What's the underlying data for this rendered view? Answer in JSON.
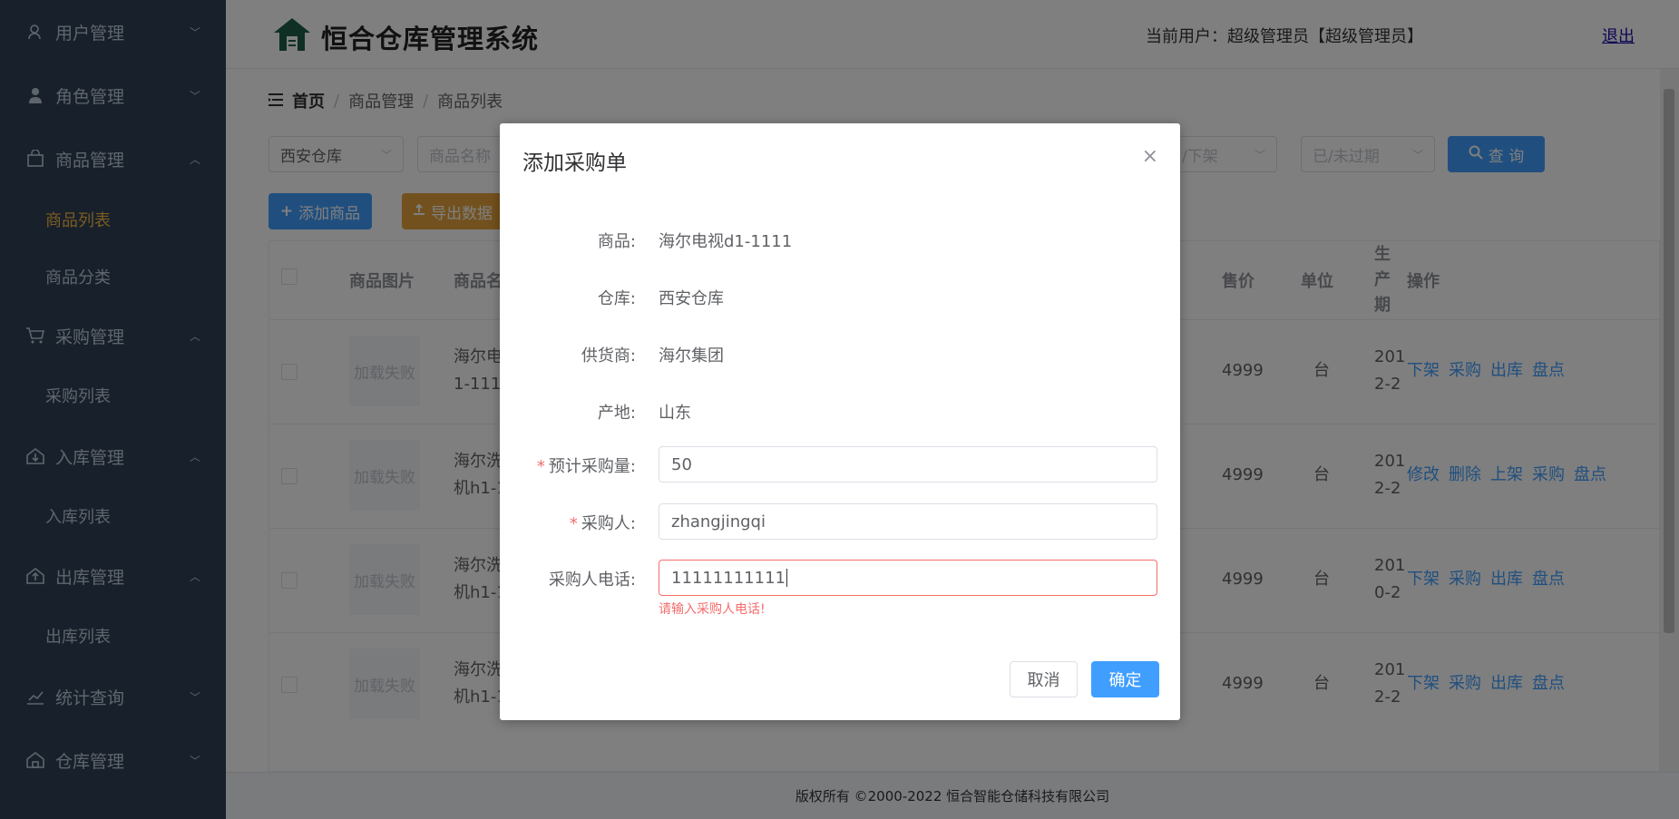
{
  "app": {
    "title": "恒合仓库管理系统",
    "user_label": "当前用户：超级管理员【超级管理员】",
    "logout": "退出"
  },
  "sidebar": {
    "menus": [
      {
        "label": "用户管理",
        "icon": "user-icon",
        "arrow": "﹀"
      },
      {
        "label": "角色管理",
        "icon": "person-icon",
        "arrow": "﹀"
      },
      {
        "label": "商品管理",
        "icon": "bag-icon",
        "arrow": "︿"
      },
      {
        "label": "采购管理",
        "icon": "cart-icon",
        "arrow": "︿"
      },
      {
        "label": "入库管理",
        "icon": "inbound-icon",
        "arrow": "︿"
      },
      {
        "label": "出库管理",
        "icon": "outbound-icon",
        "arrow": "︿"
      },
      {
        "label": "统计查询",
        "icon": "stats-icon",
        "arrow": "﹀"
      },
      {
        "label": "仓库管理",
        "icon": "warehouse-icon",
        "arrow": "﹀"
      }
    ],
    "subs": {
      "goods_list": "商品列表",
      "goods_category": "商品分类",
      "purchase_list": "采购列表",
      "inbound_list": "入库列表",
      "outbound_list": "出库列表"
    }
  },
  "breadcrumb": {
    "home": "首页",
    "level1": "商品管理",
    "level2": "商品列表",
    "sep": "/"
  },
  "filters": {
    "warehouse": "西安仓库",
    "goods_name_placeholder": "商品名称",
    "shelf_placeholder": "/下架",
    "expire_placeholder": "已/未过期",
    "query_label": "查 询"
  },
  "actions": {
    "add_goods": "添加商品",
    "export": "导出数据"
  },
  "table": {
    "headers": {
      "image": "商品图片",
      "name": "商品名",
      "price": "售价",
      "unit": "单位",
      "prod_date": "生产期",
      "ops": "操作"
    },
    "rows": [
      {
        "img": "加载失败",
        "name1": "海尔电",
        "name2": "1-1111",
        "price": "4999",
        "unit": "台",
        "date1": "201",
        "date2": "2-2",
        "ops": [
          "下架",
          "采购",
          "出库",
          "盘点"
        ]
      },
      {
        "img": "加载失败",
        "name1": "海尔洗",
        "name2": "机h1-1",
        "price": "4999",
        "unit": "台",
        "date1": "201",
        "date2": "2-2",
        "ops": [
          "修改",
          "删除",
          "上架",
          "采购",
          "盘点"
        ]
      },
      {
        "img": "加载失败",
        "name1": "海尔洗",
        "name2": "机h1-1",
        "price": "4999",
        "unit": "台",
        "date1": "201",
        "date2": "0-2",
        "ops": [
          "下架",
          "采购",
          "出库",
          "盘点"
        ]
      },
      {
        "img": "加载失败",
        "name1": "海尔洗",
        "name2": "机h1-1",
        "price": "4999",
        "unit": "台",
        "date1": "201",
        "date2": "2-2",
        "ops": [
          "下架",
          "采购",
          "出库",
          "盘点"
        ]
      }
    ]
  },
  "footer": "版权所有 ©2000-2022  恒合智能仓储科技有限公司",
  "dialog": {
    "title": "添加采购单",
    "close": "×",
    "fields": {
      "goods_label": "商品:",
      "goods_value": "海尔电视d1-1111",
      "warehouse_label": "仓库:",
      "warehouse_value": "西安仓库",
      "supplier_label": "供货商:",
      "supplier_value": "海尔集团",
      "origin_label": "产地:",
      "origin_value": "山东",
      "qty_label": "预计采购量:",
      "qty_value": "50",
      "buyer_label": "采购人:",
      "buyer_value": "zhangjingqi",
      "phone_label": "采购人电话:",
      "phone_value": "11111111111",
      "phone_error": "请输入采购人电话!",
      "required_mark": "*"
    },
    "cancel": "取消",
    "confirm": "确定"
  },
  "colors": {
    "sidebar_bg": "#304156",
    "active_menu": "#f5b942",
    "primary": "#409eff",
    "warning": "#e6a23c",
    "error": "#f56c6c"
  }
}
